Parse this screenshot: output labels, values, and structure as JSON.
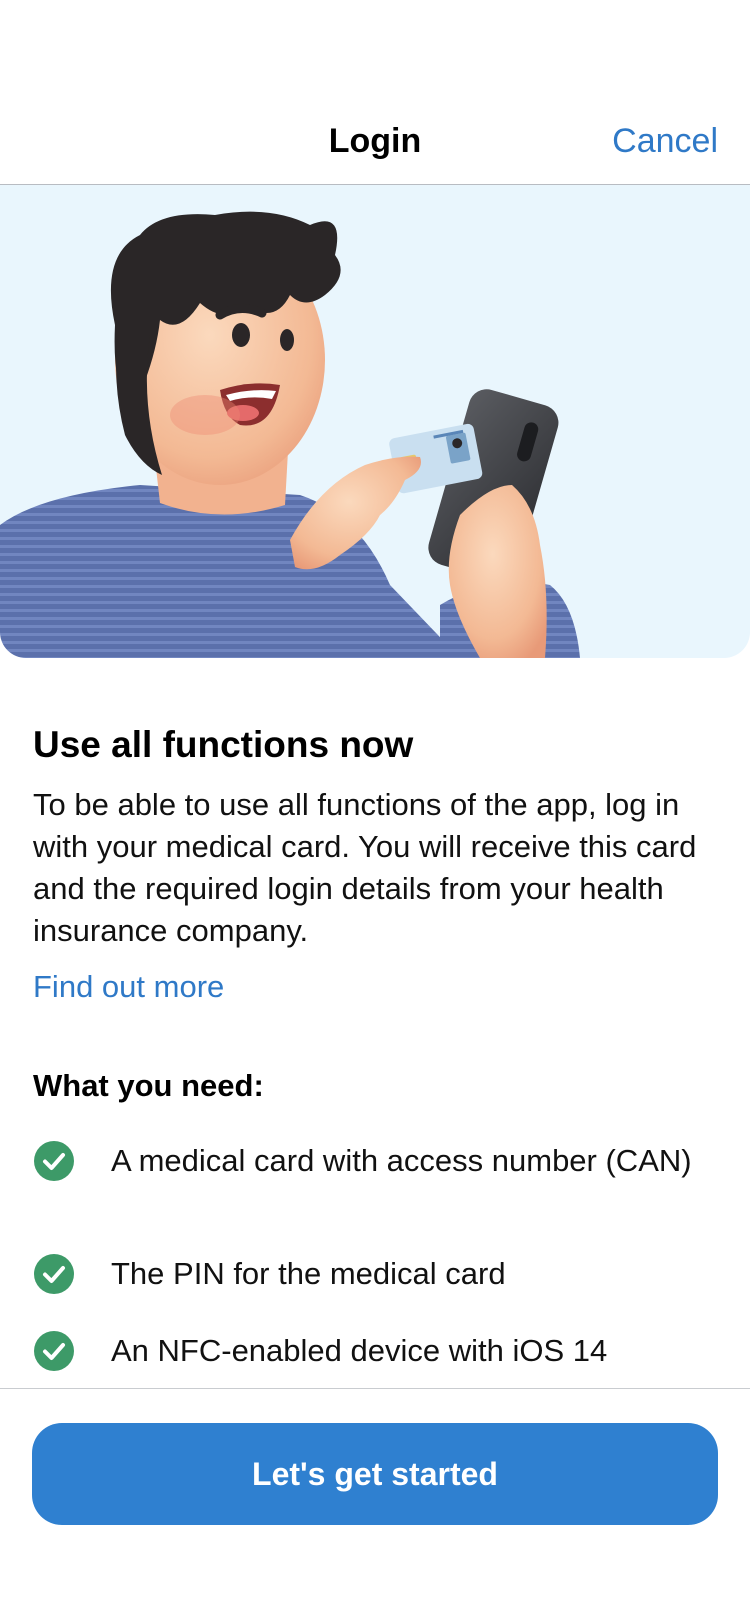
{
  "nav": {
    "title": "Login",
    "cancel": "Cancel"
  },
  "hero": {
    "illustration": "person-holding-medical-card-and-phone"
  },
  "content": {
    "headline": "Use all functions now",
    "body": "To be able to use all functions of the app, log in with your medical card. You will receive this card and the required login details from your health insurance company.",
    "link": "Find out more"
  },
  "requirements": {
    "title": "What you need:",
    "items": [
      {
        "icon": "check-circle-icon",
        "text": "A medical card with access number (CAN)"
      },
      {
        "icon": "check-circle-icon",
        "text": "The PIN for the medical card"
      },
      {
        "icon": "check-circle-icon",
        "text": "An NFC-enabled device with iOS 14"
      }
    ]
  },
  "footer": {
    "cta": "Let's get started"
  },
  "colors": {
    "accent": "#2f80d0",
    "link": "#2f79c7",
    "check": "#3d9a68",
    "hero_bg": "#e9f6fd"
  }
}
